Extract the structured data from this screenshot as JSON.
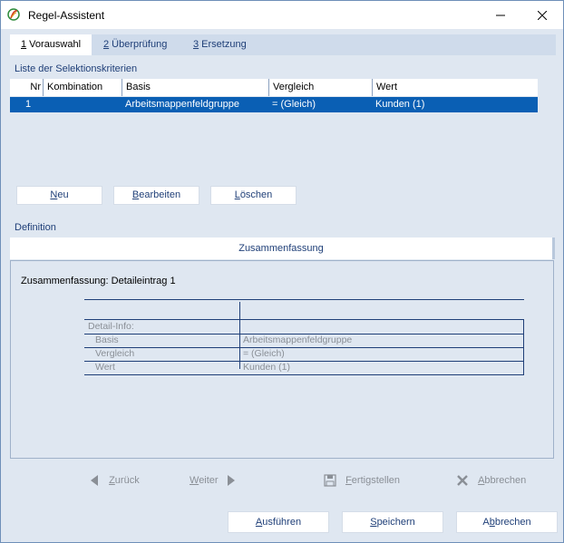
{
  "window": {
    "title": "Regel-Assistent"
  },
  "tabs": [
    {
      "num": "1",
      "label": " Vorauswahl"
    },
    {
      "num": "2",
      "label": " Überprüfung"
    },
    {
      "num": "3",
      "label": " Ersetzung"
    }
  ],
  "criteria": {
    "section_label": "Liste der Selektionskriterien",
    "columns": [
      "Nr",
      "Kombination",
      "Basis",
      "Vergleich",
      "Wert"
    ],
    "rows": [
      {
        "nr": "1",
        "kombination": "",
        "basis": "Arbeitsmappenfeldgruppe",
        "vergleich": "=  (Gleich)",
        "wert": "Kunden (1)"
      }
    ]
  },
  "buttons": {
    "neu": {
      "u": "N",
      "rest": "eu"
    },
    "bearbeiten": {
      "u": "B",
      "rest": "earbeiten"
    },
    "loeschen": {
      "u": "L",
      "rest": "öschen"
    }
  },
  "definition": {
    "section_label": "Definition",
    "tab_label": "Zusammenfassung",
    "summary_title": "Zusammenfassung: Detaileintrag 1",
    "detail_header": "Detail-Info:",
    "details": [
      {
        "key": "Basis",
        "value": "Arbeitsmappenfeldgruppe"
      },
      {
        "key": "Vergleich",
        "value": "=  (Gleich)"
      },
      {
        "key": "Wert",
        "value": "Kunden (1)"
      }
    ]
  },
  "nav": {
    "back": {
      "u": "Z",
      "rest": "urück"
    },
    "next": {
      "u": "W",
      "rest": "eiter"
    },
    "finish": {
      "u": "F",
      "rest": "ertigstellen"
    },
    "abort": {
      "u": "A",
      "rest": "bbrechen"
    }
  },
  "bottom": {
    "run": {
      "u": "A",
      "rest": "usführen"
    },
    "save": {
      "u": "S",
      "rest": "peichern"
    },
    "cancel": {
      "pre": "A",
      "u": "b",
      "rest": "brechen"
    }
  },
  "colors": {
    "accent": "#0a5fb4",
    "label_blue": "#1f3f78",
    "disabled": "#8a8f96",
    "background": "#dfe7f1"
  }
}
